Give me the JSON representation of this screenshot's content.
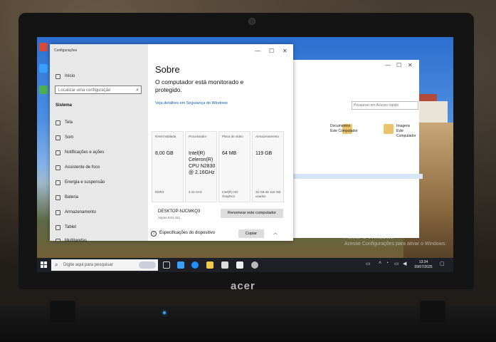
{
  "laptop": {
    "brand": "acer"
  },
  "settings_window": {
    "title": "Configurações",
    "home": "Início",
    "search_placeholder": "Localizar uma configuração",
    "section": "Sistema",
    "nav": [
      "Tela",
      "Som",
      "Notificações e ações",
      "Assistente de foco",
      "Energia e suspensão",
      "Bateria",
      "Armazenamento",
      "Tablet",
      "Multitarefas"
    ],
    "page_title": "Sobre",
    "protection": "O computador está monitorado e protegido.",
    "details_link": "Veja detalhes em Segurança do Windows",
    "cards": [
      {
        "head": "RAM instalada",
        "value": "8,00 GB",
        "foot": "DDR3"
      },
      {
        "head": "Processador",
        "value": "Intel(R) Celeron(R) CPU N2830 @ 2.16GHz",
        "foot": "2.16 GHz"
      },
      {
        "head": "Placa de vídeo",
        "value": "64 MB",
        "foot": "Intel(R) HD Graphics"
      },
      {
        "head": "Armazenamento",
        "value": "119 GB",
        "foot": "32 GB de 119 GB usados"
      }
    ],
    "device_name": "DESKTOP-NJCMKQ3",
    "device_model": "Aspire ES1-311",
    "rename_button": "Renomear este computador",
    "device_specs": "Especificações do dispositivo",
    "copy_button": "Copiar"
  },
  "explorer": {
    "search_placeholder": "Pesquisar em Acesso rápido",
    "items": [
      {
        "name": "Documentos",
        "sub": "Este Computador"
      },
      {
        "name": "Imagens",
        "sub": "Este Computador"
      }
    ]
  },
  "activation": {
    "line1": "Ativar o Windows",
    "line2": "Acesse Configurações para ativar o Windows."
  },
  "taskbar": {
    "search_placeholder": "Digite aqui para pesquisar",
    "time": "13:34",
    "date": "09/07/2025"
  }
}
